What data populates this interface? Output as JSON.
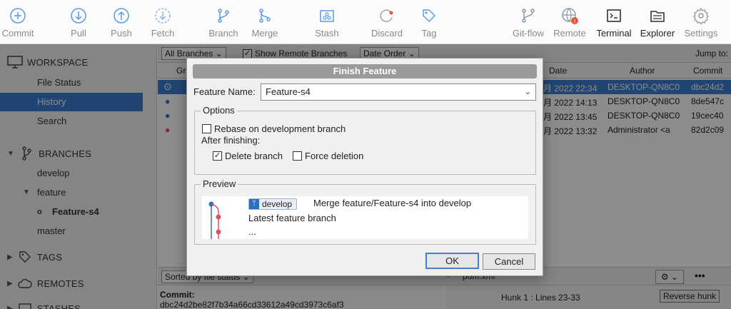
{
  "toolbar": {
    "commit": "Commit",
    "pull": "Pull",
    "push": "Push",
    "fetch": "Fetch",
    "branch": "Branch",
    "merge": "Merge",
    "stash": "Stash",
    "discard": "Discard",
    "tag": "Tag",
    "gitflow": "Git-flow",
    "remote": "Remote",
    "terminal": "Terminal",
    "explorer": "Explorer",
    "settings": "Settings"
  },
  "sidebar": {
    "workspace": "WORKSPACE",
    "file_status": "File Status",
    "history": "History",
    "search": "Search",
    "branches": "BRANCHES",
    "develop": "develop",
    "feature": "feature",
    "feature_s4": "Feature-s4",
    "master": "master",
    "tags": "TAGS",
    "remotes": "REMOTES",
    "stashes": "STASHES"
  },
  "main": {
    "filter_branches": "All Branches",
    "show_remote": "Show Remote Branches",
    "order": "Date Order",
    "jump_to": "Jump to:",
    "col_graph": "Gra",
    "col_date": "Date",
    "col_author": "Author",
    "col_commit": "Commit",
    "rows": [
      {
        "date": "月 2022 22:34",
        "author": "DESKTOP-QN8C0",
        "commit": "dbc24d2"
      },
      {
        "date": "月 2022 14:13",
        "author": "DESKTOP-QN8C0",
        "commit": "8de547c"
      },
      {
        "date": "月 2022 13:45",
        "author": "DESKTOP-QN8C0",
        "commit": "19cec40"
      },
      {
        "date": "月 2022 13:32",
        "author": "Administrator <a",
        "commit": "82d2c09"
      }
    ],
    "sort_label": "Sorted by file status",
    "commit_label": "Commit:",
    "commit_hash": "dbc24d2be82f7b34a66cd33612a49cd3973c6af3",
    "file_name": "pom.xml",
    "hunk": "Hunk 1 : Lines 23-33",
    "reverse_hunk": "Reverse hunk"
  },
  "dialog": {
    "title": "Finish Feature",
    "feature_name_label": "Feature Name:",
    "feature_name_value": "Feature-s4",
    "options_title": "Options",
    "rebase_label": "Rebase on development branch",
    "after_finishing": "After finishing:",
    "delete_branch": "Delete branch",
    "force_deletion": "Force deletion",
    "preview_title": "Preview",
    "preview_branch": "develop",
    "preview_merge_msg": "Merge feature/Feature-s4 into develop",
    "preview_latest": "Latest feature branch",
    "preview_more": "...",
    "ok": "OK",
    "cancel": "Cancel"
  },
  "colors": {
    "accent": "#3c7fd0",
    "remote_badge": "#e8553d",
    "graph_blue": "#2f6fc2",
    "graph_red": "#e0506b"
  }
}
